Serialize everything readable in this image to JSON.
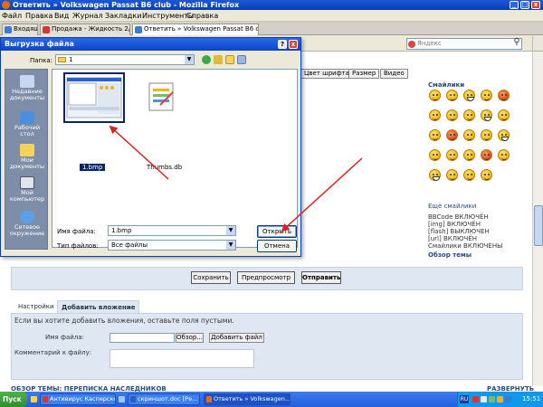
{
  "window": {
    "title": "Ответить » Volkswagen Passat B6 club - Mozilla Firefox",
    "minimize": "_",
    "maximize": "□",
    "close": "x"
  },
  "menubar": [
    "Файл",
    "Правка",
    "Вид",
    "Журнал",
    "Закладки",
    "Инструменты",
    "Справка"
  ],
  "tabs": [
    {
      "label": "Входящие",
      "active": false
    },
    {
      "label": "Продажа - Жидкость 2/3 для...",
      "active": false
    },
    {
      "label": "Ответить » Volkswagen Passat B6 club",
      "active": true
    }
  ],
  "search": {
    "placeholder": "Яндекс",
    "button": "⚲"
  },
  "editor_buttons": [
    "Цвет шрифта",
    "Размер",
    "Видео"
  ],
  "smilies": {
    "title": "Смайлики",
    "more": "Ещё смайлики",
    "count": 24
  },
  "bbcode_hints": [
    "BBCode ВКЛЮЧЁН",
    "[img] ВКЛЮЧЁН",
    "[flash] ВЫКЛЮЧЕН",
    "[url] ВКЛЮЧЁН",
    "Смайлики ВКЛЮЧЕНЫ"
  ],
  "topic_review": "Обзор темы",
  "actions": {
    "save": "Сохранить",
    "preview": "Предпросмотр",
    "submit": "Отправить"
  },
  "subtabs": [
    {
      "label": "Настройки",
      "active": false
    },
    {
      "label": "Добавить вложение",
      "active": true
    }
  ],
  "attach": {
    "note": "Если вы хотите добавить вложения, оставьте поля пустыми.",
    "file_label": "Имя файла:",
    "file_value": "",
    "browse": "Обзор...",
    "add": "Добавить файл",
    "comment_label": "Комментарий к файлу:",
    "comment_value": ""
  },
  "footer": {
    "left": "ОБЗОР ТЕМЫ: ПЕРЕПИСКА НАСЛЕДНИКОВ",
    "right": "РАЗВЕРНУТЬ"
  },
  "dialog": {
    "title": "Выгрузка файла",
    "help": "?",
    "close": "x",
    "lookin_label": "Папка:",
    "lookin_value": "1",
    "places": [
      "Недавние документы",
      "Рабочий стол",
      "Мои документы",
      "Мой компьютер",
      "Сетевое окружение"
    ],
    "files": [
      {
        "name": "1.bmp",
        "selected": true
      },
      {
        "name": "Thumbs.db",
        "selected": false
      }
    ],
    "filename_label": "Имя файла:",
    "filename_value": "1.bmp",
    "filetype_label": "Тип файлов:",
    "filetype_value": "Все файлы",
    "open": "Открыть",
    "cancel": "Отмена"
  },
  "taskbar": {
    "start": "Пуск",
    "tasks": [
      {
        "label": "Антивирус Касперского...",
        "active": false
      },
      {
        "label": "скриншот.doc [Ре...",
        "active": false
      },
      {
        "label": "Ответить » Volkswagen...",
        "active": true
      }
    ],
    "lang": "RU",
    "clock": "15:51"
  },
  "colors": {
    "arrow": "#e02020",
    "link": "#2a4c7d",
    "panel": "#dfe8f2"
  }
}
